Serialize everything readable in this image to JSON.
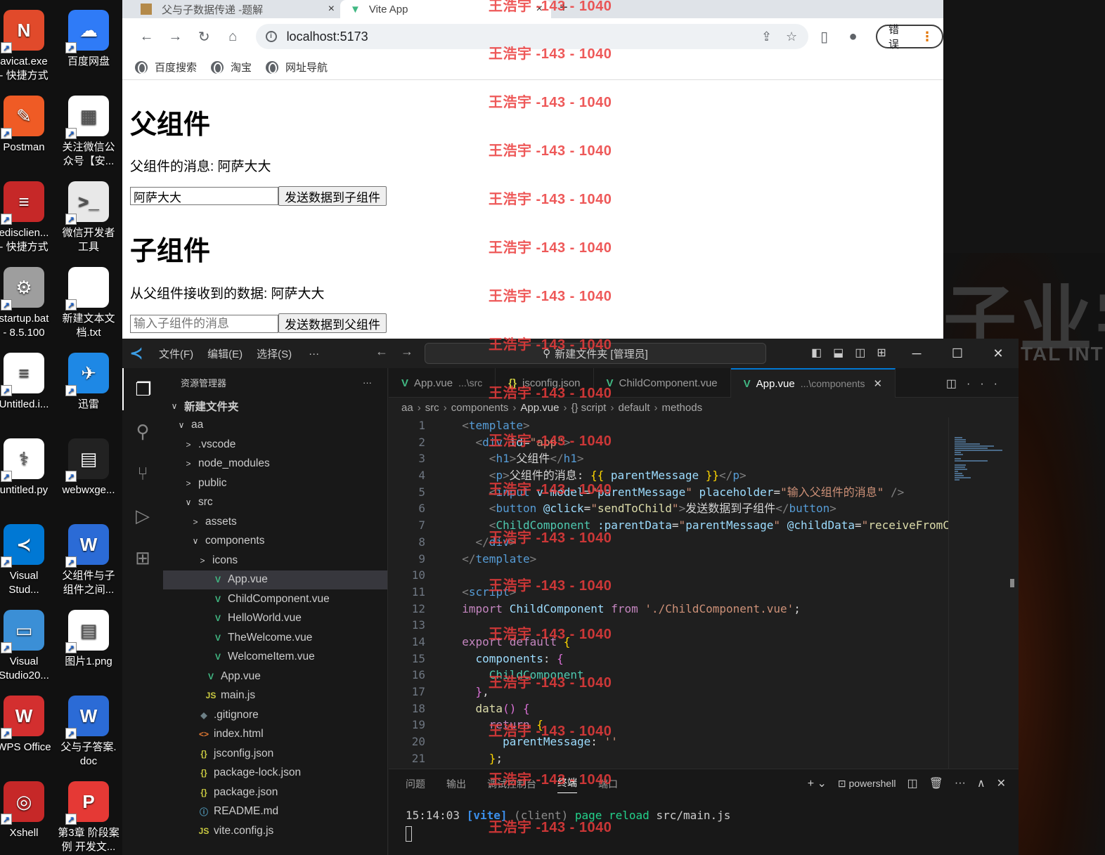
{
  "desktop": {
    "icons": [
      {
        "label": "avicat.exe\n- 快捷方式",
        "color": "#e14a2b",
        "glyph": "N",
        "name": "navicat"
      },
      {
        "label": "百度网盘",
        "color": "#2f7bf7",
        "glyph": "☁",
        "name": "baidu-netdisk"
      },
      {
        "label": "Postman",
        "color": "#ef5b25",
        "glyph": "✎",
        "name": "postman"
      },
      {
        "label": "关注微信公\n众号【安...",
        "color": "#ffffff",
        "glyph": "▦",
        "name": "wechat-qr"
      },
      {
        "label": "edisclien...\n- 快捷方式",
        "color": "#c62828",
        "glyph": "≡",
        "name": "redis-client"
      },
      {
        "label": "微信开发者\n工具",
        "color": "#e8e8e8",
        "glyph": ">_",
        "name": "wechat-devtools"
      },
      {
        "label": "startup.bat\n- 8.5.100",
        "color": "#9e9e9e",
        "glyph": "⚙",
        "name": "startup-bat"
      },
      {
        "label": "新建文本文\n档.txt",
        "color": "#ffffff",
        "glyph": "",
        "name": "new-text-doc"
      },
      {
        "label": "Untitled.i...",
        "color": "#ffffff",
        "glyph": "≡",
        "name": "untitled-ipynb"
      },
      {
        "label": "迅雷",
        "color": "#1e88e5",
        "glyph": "✈",
        "name": "xunlei"
      },
      {
        "label": "untitled.py",
        "color": "#ffffff",
        "glyph": "⚕",
        "name": "untitled-py"
      },
      {
        "label": "webwxge...",
        "color": "#222222",
        "glyph": "▤",
        "name": "webwxgetmsg"
      },
      {
        "label": "Visual\nStud...",
        "color": "#0078d4",
        "glyph": "≺",
        "name": "vscode-shortcut"
      },
      {
        "label": "父组件与子\n组件之间...",
        "color": "#2b6bd6",
        "glyph": "W",
        "name": "word-doc-parent-child"
      },
      {
        "label": "Visual\nStudio20...",
        "color": "#3b8fd6",
        "glyph": "▭",
        "name": "visual-studio"
      },
      {
        "label": "图片1.png",
        "color": "#ffffff",
        "glyph": "▤",
        "name": "picture1-png"
      },
      {
        "label": "WPS Office",
        "color": "#d32f2f",
        "glyph": "W",
        "name": "wps-office"
      },
      {
        "label": "父与子答案.\ndoc",
        "color": "#2b6bd6",
        "glyph": "W",
        "name": "answer-doc"
      },
      {
        "label": "Xshell",
        "color": "#c62828",
        "glyph": "◎",
        "name": "xshell"
      },
      {
        "label": "第3章 阶段案\n例 开发文...",
        "color": "#e53935",
        "glyph": "P",
        "name": "chapter3-pdf"
      }
    ],
    "wallpaper_big_text": "子业学",
    "wallpaper_small_text": "TAL INTE"
  },
  "browser": {
    "tabs": [
      {
        "title": "父与子数据传递 -题解",
        "close": "×"
      },
      {
        "title": "Vite App",
        "close": "×"
      }
    ],
    "new_tab": "+",
    "url": "localhost:5173",
    "error_label": "错误",
    "bookmarks": [
      "百度搜索",
      "淘宝",
      "网址导航"
    ]
  },
  "page": {
    "parent_heading": "父组件",
    "parent_message_label": "父组件的消息: 阿萨大大",
    "parent_input_value": "阿萨大大",
    "parent_input_placeholder": "输入父组件的消息",
    "send_to_child_button": "发送数据到子组件",
    "child_heading": "子组件",
    "child_received_label": "从父组件接收到的数据: 阿萨大大",
    "child_input_placeholder": "输入子组件的消息",
    "send_to_parent_button": "发送数据到父组件"
  },
  "vscode": {
    "menu": [
      "文件(F)",
      "编辑(E)",
      "选择(S)",
      "···"
    ],
    "command_center": "新建文件夹 [管理员]",
    "explorer_title": "资源管理器",
    "explorer_more": "···",
    "tree": [
      {
        "label": "新建文件夹",
        "indent": 0,
        "chev": "∨",
        "icon": "",
        "bold": true
      },
      {
        "label": "aa",
        "indent": 1,
        "chev": "∨",
        "icon": ""
      },
      {
        "label": ".vscode",
        "indent": 2,
        "chev": ">",
        "icon": ""
      },
      {
        "label": "node_modules",
        "indent": 2,
        "chev": ">",
        "icon": ""
      },
      {
        "label": "public",
        "indent": 2,
        "chev": ">",
        "icon": ""
      },
      {
        "label": "src",
        "indent": 2,
        "chev": "∨",
        "icon": ""
      },
      {
        "label": "assets",
        "indent": 3,
        "chev": ">",
        "icon": ""
      },
      {
        "label": "components",
        "indent": 3,
        "chev": "∨",
        "icon": ""
      },
      {
        "label": "icons",
        "indent": 4,
        "chev": ">",
        "icon": ""
      },
      {
        "label": "App.vue",
        "indent": 4,
        "chev": "",
        "icon": "vue",
        "selected": true
      },
      {
        "label": "ChildComponent.vue",
        "indent": 4,
        "chev": "",
        "icon": "vue"
      },
      {
        "label": "HelloWorld.vue",
        "indent": 4,
        "chev": "",
        "icon": "vue"
      },
      {
        "label": "TheWelcome.vue",
        "indent": 4,
        "chev": "",
        "icon": "vue"
      },
      {
        "label": "WelcomeItem.vue",
        "indent": 4,
        "chev": "",
        "icon": "vue"
      },
      {
        "label": "App.vue",
        "indent": 3,
        "chev": "",
        "icon": "vue"
      },
      {
        "label": "main.js",
        "indent": 3,
        "chev": "",
        "icon": "js"
      },
      {
        "label": ".gitignore",
        "indent": 2,
        "chev": "",
        "icon": "git"
      },
      {
        "label": "index.html",
        "indent": 2,
        "chev": "",
        "icon": "html"
      },
      {
        "label": "jsconfig.json",
        "indent": 2,
        "chev": "",
        "icon": "json"
      },
      {
        "label": "package-lock.json",
        "indent": 2,
        "chev": "",
        "icon": "json"
      },
      {
        "label": "package.json",
        "indent": 2,
        "chev": "",
        "icon": "json"
      },
      {
        "label": "README.md",
        "indent": 2,
        "chev": "",
        "icon": "info"
      },
      {
        "label": "vite.config.js",
        "indent": 2,
        "chev": "",
        "icon": "js"
      }
    ],
    "editor_tabs": [
      {
        "label": "App.vue",
        "hint": "...\\src",
        "icon": "vue",
        "active": false
      },
      {
        "label": "jsconfig.json",
        "hint": "",
        "icon": "json",
        "active": false
      },
      {
        "label": "ChildComponent.vue",
        "hint": "",
        "icon": "vue",
        "active": false
      },
      {
        "label": "App.vue",
        "hint": "...\\components",
        "icon": "vue",
        "active": true
      }
    ],
    "breadcrumbs": [
      "aa",
      "src",
      "components",
      "App.vue",
      "{} script",
      "default",
      "methods"
    ],
    "code_lines": [
      [
        [
          "t-br",
          "  "
        ],
        [
          "t-br",
          "<"
        ],
        [
          "t-tag",
          "template"
        ],
        [
          "t-br",
          ">"
        ]
      ],
      [
        [
          "",
          "    "
        ],
        [
          "t-br",
          "<"
        ],
        [
          "t-tag",
          "div"
        ],
        [
          "",
          " "
        ],
        [
          "t-attr",
          "id"
        ],
        [
          "",
          "="
        ],
        [
          "t-str",
          "\"app\""
        ],
        [
          "t-br",
          ">"
        ]
      ],
      [
        [
          "",
          "      "
        ],
        [
          "t-br",
          "<"
        ],
        [
          "t-tag",
          "h1"
        ],
        [
          "t-br",
          ">"
        ],
        [
          "",
          "父组件"
        ],
        [
          "t-br",
          "</"
        ],
        [
          "t-tag",
          "h1"
        ],
        [
          "t-br",
          ">"
        ]
      ],
      [
        [
          "",
          "      "
        ],
        [
          "t-br",
          "<"
        ],
        [
          "t-tag",
          "p"
        ],
        [
          "t-br",
          ">"
        ],
        [
          "",
          "父组件的消息: "
        ],
        [
          "t-brace",
          "{{"
        ],
        [
          "",
          " "
        ],
        [
          "t-attr",
          "parentMessage"
        ],
        [
          "",
          " "
        ],
        [
          "t-brace",
          "}}"
        ],
        [
          "t-br",
          "</"
        ],
        [
          "t-tag",
          "p"
        ],
        [
          "t-br",
          ">"
        ]
      ],
      [
        [
          "",
          "      "
        ],
        [
          "t-br",
          "<"
        ],
        [
          "t-tag",
          "input"
        ],
        [
          "",
          " "
        ],
        [
          "t-attr",
          "v-model"
        ],
        [
          "",
          "="
        ],
        [
          "t-str",
          "\""
        ],
        [
          "t-attr",
          "parentMessage"
        ],
        [
          "t-str",
          "\""
        ],
        [
          "",
          " "
        ],
        [
          "t-attr",
          "placeholder"
        ],
        [
          "",
          "="
        ],
        [
          "t-str",
          "\"输入父组件的消息\""
        ],
        [
          "",
          " "
        ],
        [
          "t-br",
          "/>"
        ]
      ],
      [
        [
          "",
          "      "
        ],
        [
          "t-br",
          "<"
        ],
        [
          "t-tag",
          "button"
        ],
        [
          "",
          " "
        ],
        [
          "t-at",
          "@click"
        ],
        [
          "",
          "="
        ],
        [
          "t-str",
          "\""
        ],
        [
          "t-fn",
          "sendToChild"
        ],
        [
          "t-str",
          "\""
        ],
        [
          "t-br",
          ">"
        ],
        [
          "",
          "发送数据到子组件"
        ],
        [
          "t-br",
          "</"
        ],
        [
          "t-tag",
          "button"
        ],
        [
          "t-br",
          ">"
        ]
      ],
      [
        [
          "",
          "      "
        ],
        [
          "t-br",
          "<"
        ],
        [
          "t-cls",
          "ChildComponent"
        ],
        [
          "",
          " "
        ],
        [
          "t-attr",
          ":parentData"
        ],
        [
          "",
          "="
        ],
        [
          "t-str",
          "\""
        ],
        [
          "t-attr",
          "parentMessage"
        ],
        [
          "t-str",
          "\""
        ],
        [
          "",
          " "
        ],
        [
          "t-at",
          "@childData"
        ],
        [
          "",
          "="
        ],
        [
          "t-str",
          "\""
        ],
        [
          "t-fn",
          "receiveFromChi"
        ]
      ],
      [
        [
          "",
          "    "
        ],
        [
          "t-br",
          "</"
        ],
        [
          "t-tag",
          "div"
        ],
        [
          "t-br",
          ">"
        ]
      ],
      [
        [
          "",
          "  "
        ],
        [
          "t-br",
          "</"
        ],
        [
          "t-tag",
          "template"
        ],
        [
          "t-br",
          ">"
        ]
      ],
      [
        [
          "",
          ""
        ]
      ],
      [
        [
          "",
          "  "
        ],
        [
          "t-br",
          "<"
        ],
        [
          "t-tag",
          "script"
        ],
        [
          "t-br",
          ">"
        ]
      ],
      [
        [
          "",
          "  "
        ],
        [
          "t-kw",
          "import"
        ],
        [
          "",
          " "
        ],
        [
          "t-attr",
          "ChildComponent"
        ],
        [
          "",
          " "
        ],
        [
          "t-kw",
          "from"
        ],
        [
          "",
          " "
        ],
        [
          "t-str",
          "'./ChildComponent.vue'"
        ],
        [
          "",
          ";"
        ]
      ],
      [
        [
          "",
          ""
        ]
      ],
      [
        [
          "",
          "  "
        ],
        [
          "t-kw",
          "export"
        ],
        [
          "",
          " "
        ],
        [
          "t-kw",
          "default"
        ],
        [
          "",
          " "
        ],
        [
          "t-brace",
          "{"
        ]
      ],
      [
        [
          "",
          "    "
        ],
        [
          "t-attr",
          "components"
        ],
        [
          "",
          ": "
        ],
        [
          "t-vbrace",
          "{"
        ]
      ],
      [
        [
          "",
          "      "
        ],
        [
          "t-cls",
          "ChildComponent"
        ]
      ],
      [
        [
          "",
          "    "
        ],
        [
          "t-vbrace",
          "}"
        ],
        [
          "",
          ","
        ]
      ],
      [
        [
          "",
          "    "
        ],
        [
          "t-fn",
          "data"
        ],
        [
          "t-vbrace",
          "()"
        ],
        [
          "",
          " "
        ],
        [
          "t-vbrace",
          "{"
        ]
      ],
      [
        [
          "",
          "      "
        ],
        [
          "t-kw",
          "return"
        ],
        [
          "",
          " "
        ],
        [
          "t-brace",
          "{"
        ]
      ],
      [
        [
          "",
          "        "
        ],
        [
          "t-attr",
          "parentMessage"
        ],
        [
          "",
          ": "
        ],
        [
          "t-str",
          "''"
        ]
      ],
      [
        [
          "",
          "      "
        ],
        [
          "t-brace",
          "}"
        ],
        [
          "",
          ";"
        ]
      ]
    ],
    "panel_tabs": [
      "问题",
      "输出",
      "调试控制台",
      "终端",
      "端口"
    ],
    "panel_active": "终端",
    "shell_name": "powershell",
    "terminal": {
      "time": "15:14:03",
      "vite": "[vite]",
      "client": "(client)",
      "reload": "page reload",
      "file": "src/main.js"
    }
  },
  "watermark": "王浩宇 -143 - 1040"
}
